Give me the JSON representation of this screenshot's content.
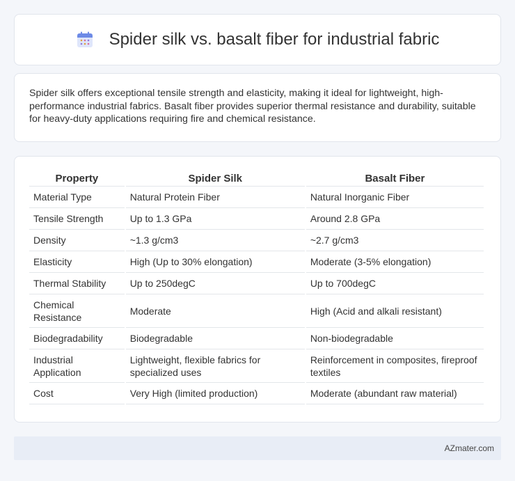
{
  "header": {
    "title": "Spider silk vs. basalt fiber for industrial fabric",
    "icon": "calendar-icon",
    "icon_color": "#5b7be0"
  },
  "summary": {
    "text": "Spider silk offers exceptional tensile strength and elasticity, making it ideal for lightweight, high-performance industrial fabrics. Basalt fiber provides superior thermal resistance and durability, suitable for heavy-duty applications requiring fire and chemical resistance."
  },
  "table": {
    "headers": [
      "Property",
      "Spider Silk",
      "Basalt Fiber"
    ],
    "rows": [
      [
        "Material Type",
        "Natural Protein Fiber",
        "Natural Inorganic Fiber"
      ],
      [
        "Tensile Strength",
        "Up to 1.3 GPa",
        "Around 2.8 GPa"
      ],
      [
        "Density",
        "~1.3 g/cm3",
        "~2.7 g/cm3"
      ],
      [
        "Elasticity",
        "High (Up to 30% elongation)",
        "Moderate (3-5% elongation)"
      ],
      [
        "Thermal Stability",
        "Up to 250degC",
        "Up to 700degC"
      ],
      [
        "Chemical Resistance",
        "Moderate",
        "High (Acid and alkali resistant)"
      ],
      [
        "Biodegradability",
        "Biodegradable",
        "Non-biodegradable"
      ],
      [
        "Industrial Application",
        "Lightweight, flexible fabrics for specialized uses",
        "Reinforcement in composites, fireproof textiles"
      ],
      [
        "Cost",
        "Very High (limited production)",
        "Moderate (abundant raw material)"
      ]
    ]
  },
  "footer": {
    "brand": "AZmater.com"
  }
}
